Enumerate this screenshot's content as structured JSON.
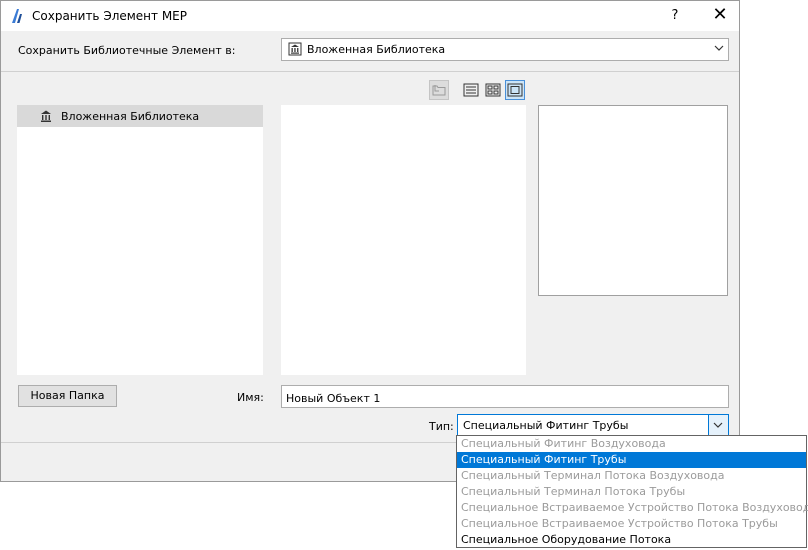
{
  "window": {
    "title": "Сохранить Элемент MEP",
    "help_label": "?",
    "close_label": "✕"
  },
  "save_location": {
    "label": "Сохранить Библиотечные Элемент в:",
    "value": "Вложенная Библиотека"
  },
  "view_buttons": [
    {
      "name": "up-folder",
      "state": "disabled"
    },
    {
      "name": "list-view",
      "state": "normal"
    },
    {
      "name": "icon-view",
      "state": "normal"
    },
    {
      "name": "preview-view",
      "state": "active"
    }
  ],
  "tree": {
    "items": [
      {
        "label": "Вложенная Библиотека",
        "icon": "library-icon",
        "selected": true
      }
    ]
  },
  "buttons": {
    "new_folder": "Новая Папка"
  },
  "name_field": {
    "label": "Имя:",
    "value": "Новый Объект 1"
  },
  "type_field": {
    "label": "Тип:",
    "value": "Специальный Фитинг Трубы",
    "options": [
      {
        "label": "Специальный Фитинг Воздуховода",
        "state": "disabled"
      },
      {
        "label": "Специальный Фитинг Трубы",
        "state": "selected"
      },
      {
        "label": "Специальный Терминал Потока Воздуховода",
        "state": "disabled"
      },
      {
        "label": "Специальный Терминал Потока Трубы",
        "state": "disabled"
      },
      {
        "label": "Специальное Встраиваемое Устройство Потока Воздуховода",
        "state": "disabled"
      },
      {
        "label": "Специальное Встраиваемое Устройство Потока Трубы",
        "state": "disabled"
      },
      {
        "label": "Специальное Оборудование Потока",
        "state": "enabled"
      }
    ]
  },
  "colors": {
    "accent": "#0078d7",
    "dialog_bg": "#f0f0f0",
    "disabled_text": "#9b9b9b"
  }
}
